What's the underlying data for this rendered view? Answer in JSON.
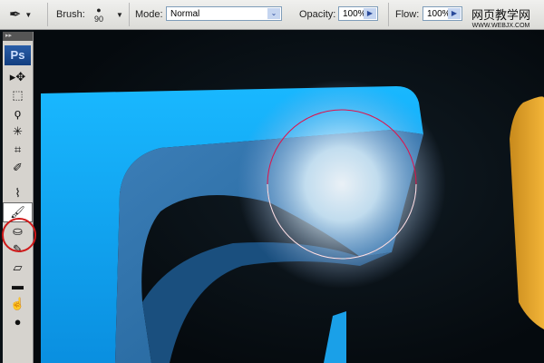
{
  "options_bar": {
    "brush_label": "Brush:",
    "brush_size": "90",
    "mode_label": "Mode:",
    "mode_value": "Normal",
    "opacity_label": "Opacity:",
    "opacity_value": "100%",
    "flow_label": "Flow:",
    "flow_value": "100%"
  },
  "watermark": {
    "line1": "网页教学网",
    "line2": "WWW.WEBJX.COM"
  },
  "toolbox": {
    "logo": "Ps",
    "tools": [
      {
        "name": "move-tool",
        "glyph": "▸✥"
      },
      {
        "name": "marquee-tool",
        "glyph": "⬚"
      },
      {
        "name": "lasso-tool",
        "glyph": "ϙ"
      },
      {
        "name": "magic-wand-tool",
        "glyph": "✳"
      },
      {
        "name": "crop-tool",
        "glyph": "⌗"
      },
      {
        "name": "slice-tool",
        "glyph": "✐"
      },
      {
        "name": "healing-brush-tool",
        "glyph": "⌇"
      },
      {
        "name": "brush-tool",
        "glyph": "🖌"
      },
      {
        "name": "clone-stamp-tool",
        "glyph": "⛀"
      },
      {
        "name": "history-brush-tool",
        "glyph": "✎"
      },
      {
        "name": "eraser-tool",
        "glyph": "▱"
      },
      {
        "name": "gradient-tool",
        "glyph": "▬"
      },
      {
        "name": "smudge-tool",
        "glyph": "☝"
      },
      {
        "name": "dodge-tool",
        "glyph": "●"
      }
    ]
  },
  "colors": {
    "accent": "#1ec8ff",
    "highlight_circle": "#e0104a"
  }
}
